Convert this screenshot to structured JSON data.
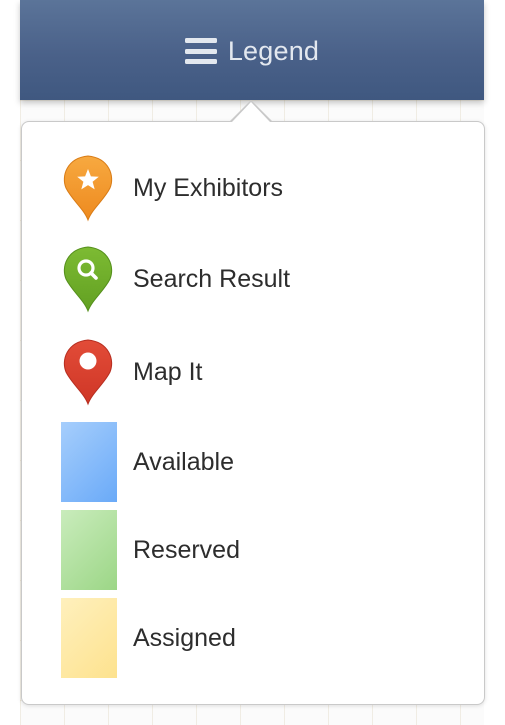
{
  "header": {
    "icon": "hamburger-menu-icon",
    "title": "Legend",
    "background_color": "#4a6189",
    "text_color": "#e3e8ef"
  },
  "legend": {
    "items": [
      {
        "label": "My Exhibitors",
        "icon": "orange-star-pin-icon",
        "color": "#f39a2c"
      },
      {
        "label": "Search Result",
        "icon": "green-search-pin-icon",
        "color": "#6fad2a"
      },
      {
        "label": "Map It",
        "icon": "red-dot-pin-icon",
        "color": "#d9412f"
      },
      {
        "label": "Available",
        "icon": "blue-swatch",
        "color": "#78b4fb"
      },
      {
        "label": "Reserved",
        "icon": "green-swatch",
        "color": "#a8dc94"
      },
      {
        "label": "Assigned",
        "icon": "yellow-swatch",
        "color": "#fde597"
      }
    ]
  }
}
